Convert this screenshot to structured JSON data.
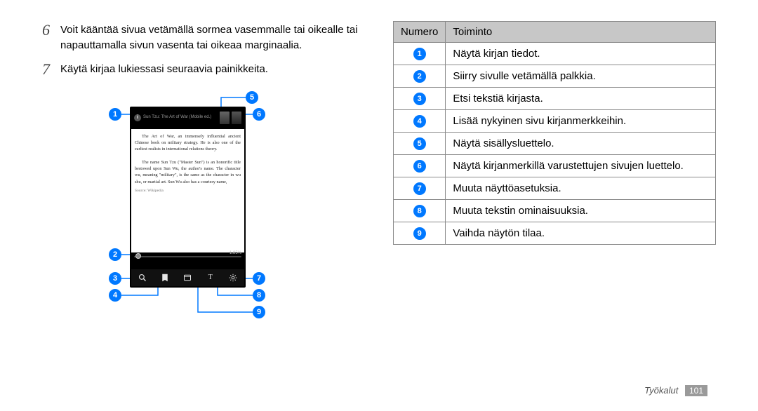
{
  "steps": {
    "s6_num": "6",
    "s6_text": "Voit kääntää sivua vetämällä sormea vasemmalle tai oikealle tai napauttamalla sivun vasenta tai oikeaa marginaalia.",
    "s7_num": "7",
    "s7_text": "Käytä kirjaa lukiessasi seuraavia painikkeita."
  },
  "callouts": {
    "c1": "1",
    "c2": "2",
    "c3": "3",
    "c4": "4",
    "c5": "5",
    "c6": "6",
    "c7": "7",
    "c8": "8",
    "c9": "9"
  },
  "reader": {
    "title": "Sun Tzu: The Art of War (Mobile ed.)",
    "para1": "The Art of War, an immensely influential ancient Chinese book on military strategy. He is also one of the earliest realists in international relations theory.",
    "para2": "The name Sun Tzu (\"Master Sun\") is an honorific title bestowed upon Sun Wu, the author's name. The character wu, meaning \"military\", is the same as the character in wu shu, or martial art. Sun Wu also has a courtesy name,",
    "source": "Source: Wikipedia",
    "percent": "1.85%",
    "fontT": "T"
  },
  "table": {
    "h1": "Numero",
    "h2": "Toiminto",
    "r1": "Näytä kirjan tiedot.",
    "r2": "Siirry sivulle vetämällä palkkia.",
    "r3": "Etsi tekstiä kirjasta.",
    "r4": "Lisää nykyinen sivu kirjanmerkkeihin.",
    "r5": "Näytä sisällysluettelo.",
    "r6": "Näytä kirjanmerkillä varustettujen sivujen luettelo.",
    "r7": "Muuta näyttöasetuksia.",
    "r8": "Muuta tekstin ominaisuuksia.",
    "r9": "Vaihda näytön tilaa."
  },
  "footer": {
    "section": "Työkalut",
    "page": "101"
  }
}
